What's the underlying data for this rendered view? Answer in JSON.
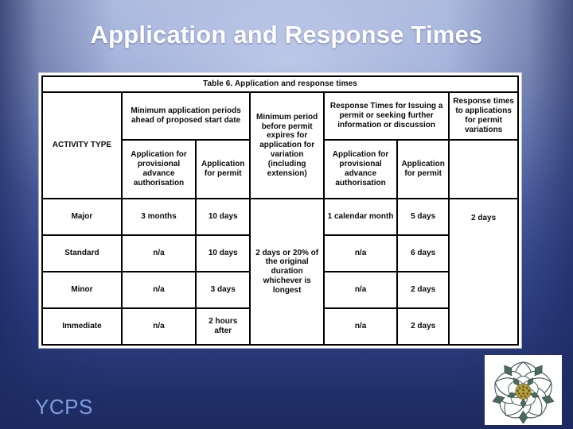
{
  "slide": {
    "title": "Application and Response Times",
    "footer_label": "YCPS",
    "logo_name": "yorkshire-rose-emblem",
    "colors": {
      "title_text": "#ffffff",
      "footer_text": "#7e9ee0",
      "background_top": "#aab7dc",
      "background_bottom": "#1d2a5e",
      "table_border": "#000000",
      "table_background": "#ffffff"
    }
  },
  "table": {
    "caption": "Table 6.  Application and response times",
    "header_row_1": {
      "activity_type": "ACTIVITY TYPE",
      "min_application_periods": "Minimum application periods ahead of proposed start date",
      "min_period_before_expiry": "Minimum period before permit expires for application for variation (including extension)",
      "response_times_issuing": "Response Times for Issuing a permit or seeking further information or discussion",
      "response_times_variations": "Response times to applications for permit variations"
    },
    "header_row_2": {
      "activity_type": "",
      "app_provisional_advance": "Application for provisional advance authorisation",
      "app_for_permit": "Application for permit",
      "resp_provisional_advance": "Application for provisional advance authorisation",
      "resp_for_permit": "Application for permit",
      "variations": ""
    },
    "merged_cells": {
      "min_period_before_expiry_value": "2 days or 20% of the original duration whichever is longest",
      "response_variations_value": "2 days"
    },
    "rows": [
      {
        "activity_type": "Major",
        "app_provisional_advance": "3 months",
        "app_for_permit": "10 days",
        "resp_provisional_advance": "1 calendar month",
        "resp_for_permit": "5 days"
      },
      {
        "activity_type": "Standard",
        "app_provisional_advance": "n/a",
        "app_for_permit": "10 days",
        "resp_provisional_advance": "n/a",
        "resp_for_permit": "6 days"
      },
      {
        "activity_type": "Minor",
        "app_provisional_advance": "n/a",
        "app_for_permit": "3 days",
        "resp_provisional_advance": "n/a",
        "resp_for_permit": "2 days"
      },
      {
        "activity_type": "Immediate",
        "app_provisional_advance": "n/a",
        "app_for_permit": "2 hours after",
        "resp_provisional_advance": "n/a",
        "resp_for_permit": "2 days"
      }
    ]
  }
}
